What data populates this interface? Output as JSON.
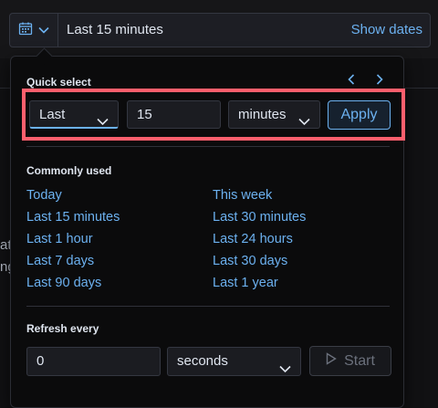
{
  "header": {
    "range_text": "Last 15 minutes",
    "show_dates": "Show dates",
    "calendar_icon": "calendar-icon",
    "chevron_icon": "chevron-down-icon"
  },
  "background": {
    "partial_text_1": "at",
    "partial_text_2": "ng"
  },
  "quick_select": {
    "title": "Quick select",
    "prev_icon": "chevron-left-icon",
    "next_icon": "chevron-right-icon",
    "tense": "Last",
    "value": "15",
    "unit": "minutes",
    "apply_label": "Apply"
  },
  "commonly_used": {
    "title": "Commonly used",
    "left": [
      "Today",
      "Last 15 minutes",
      "Last 1 hour",
      "Last 7 days",
      "Last 90 days"
    ],
    "right": [
      "This week",
      "Last 30 minutes",
      "Last 24 hours",
      "Last 30 days",
      "Last 1 year"
    ]
  },
  "refresh": {
    "title": "Refresh every",
    "value": "0",
    "unit": "seconds",
    "start_label": "Start",
    "play_icon": "play-icon"
  },
  "colors": {
    "link": "#6cb1f0",
    "highlight": "#ff5f6d",
    "panel": "#0b0b0c"
  }
}
